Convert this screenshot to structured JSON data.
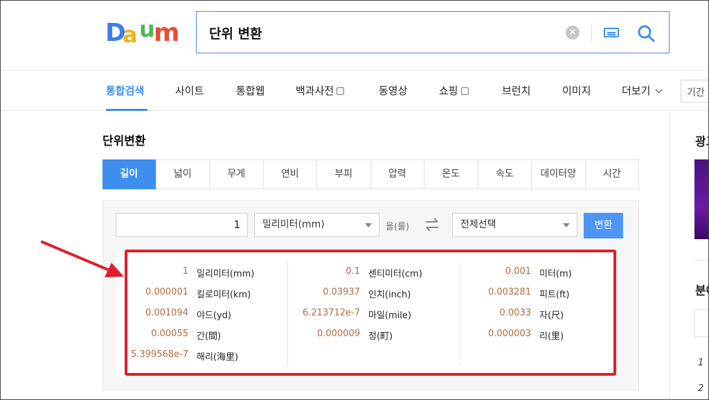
{
  "logo": {
    "letters": [
      "D",
      "a",
      "u",
      "m"
    ]
  },
  "search": {
    "query": "단위 변환",
    "clear_icon": "×"
  },
  "nav": {
    "items": [
      "통합검색",
      "사이트",
      "통합웹",
      "백과사전",
      "동영상",
      "쇼핑",
      "브런치",
      "이미지",
      "더보기"
    ],
    "period_label": "기간"
  },
  "sidebar_right": {
    "title1": "광고",
    "title2": "분야",
    "nums": [
      "1",
      "2"
    ]
  },
  "converter": {
    "title": "단위변환",
    "tabs": [
      "길이",
      "넓이",
      "무게",
      "연비",
      "부피",
      "압력",
      "온도",
      "속도",
      "데이터양",
      "시간"
    ],
    "active_tab": "길이",
    "input_value": "1",
    "from_unit": "밀리미터(mm)",
    "particle": "을(를)",
    "to_unit": "전체선택",
    "convert_button": "변환",
    "results": [
      [
        {
          "value": "1",
          "unit": "밀리미터(mm)"
        },
        {
          "value": "0.000001",
          "unit": "킬로미터(km)"
        },
        {
          "value": "0.001094",
          "unit": "야드(yd)"
        },
        {
          "value": "0.00055",
          "unit": "간(間)"
        },
        {
          "value": "5.399568e-7",
          "unit": "해리(海里)"
        }
      ],
      [
        {
          "value": "0.1",
          "unit": "센티미터(cm)"
        },
        {
          "value": "0.03937",
          "unit": "인치(inch)"
        },
        {
          "value": "6.213712e-7",
          "unit": "마일(mile)"
        },
        {
          "value": "0.000009",
          "unit": "정(町)"
        }
      ],
      [
        {
          "value": "0.001",
          "unit": "미터(m)"
        },
        {
          "value": "0.003281",
          "unit": "피트(ft)"
        },
        {
          "value": "0.0033",
          "unit": "자(尺)"
        },
        {
          "value": "0.000003",
          "unit": "리(里)"
        }
      ]
    ]
  },
  "colors": {
    "accent": "#3e8ef0",
    "highlight": "#e01e2b",
    "value_text": "#b36a3e"
  }
}
